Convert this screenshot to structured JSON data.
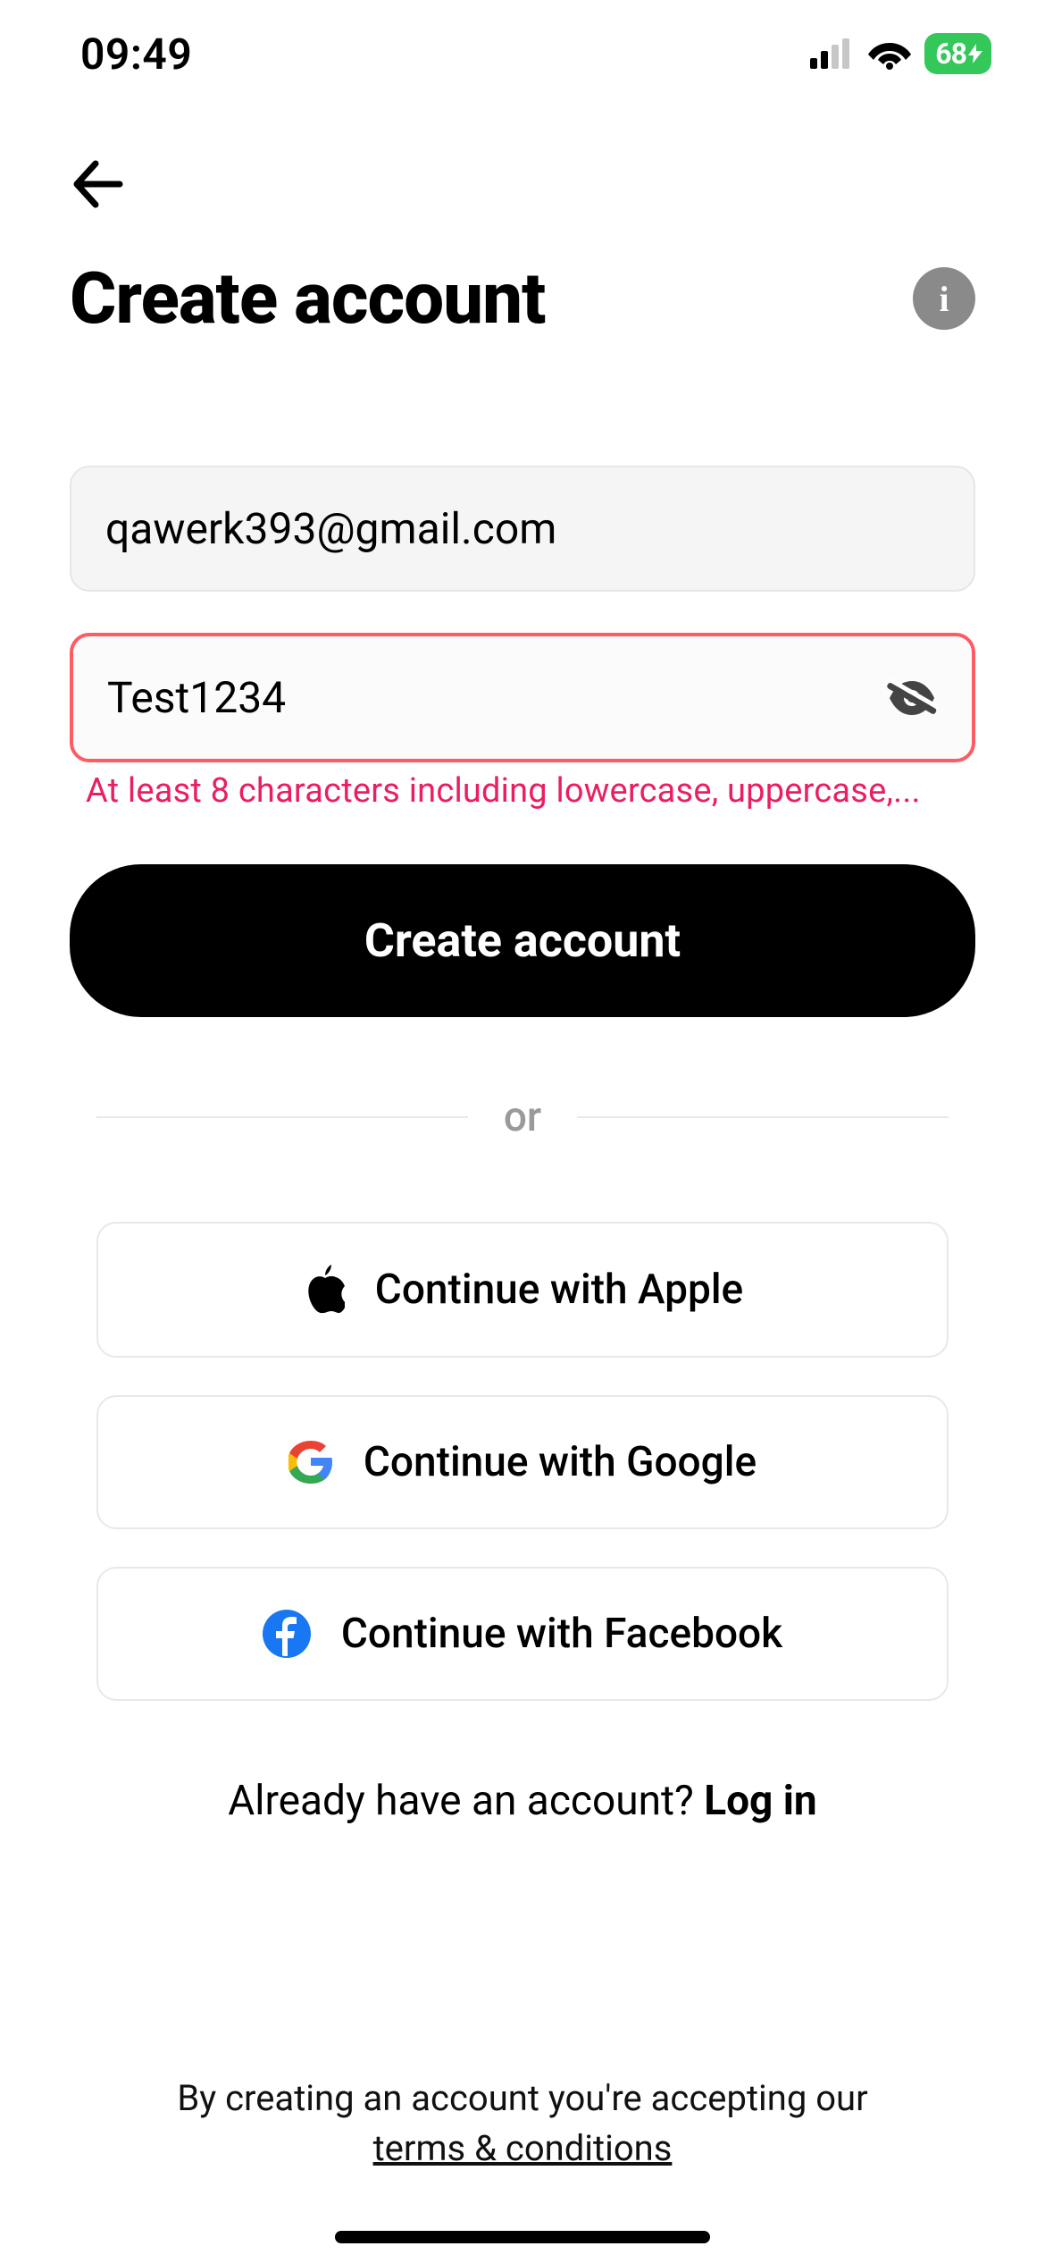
{
  "status_bar": {
    "time": "09:49",
    "battery": "68"
  },
  "header": {
    "title": "Create account"
  },
  "form": {
    "email_value": "qawerk393@gmail.com",
    "password_value": "Test1234",
    "password_error": "At least 8 characters including lowercase, uppercase,..."
  },
  "primary_button": "Create account",
  "divider_text": "or",
  "social": {
    "apple": "Continue with Apple",
    "google": "Continue with Google",
    "facebook": "Continue with Facebook"
  },
  "login_prompt": {
    "text": "Already have an account? ",
    "link": "Log in"
  },
  "terms": {
    "text": "By creating an account you're accepting our",
    "link": "terms & conditions"
  }
}
